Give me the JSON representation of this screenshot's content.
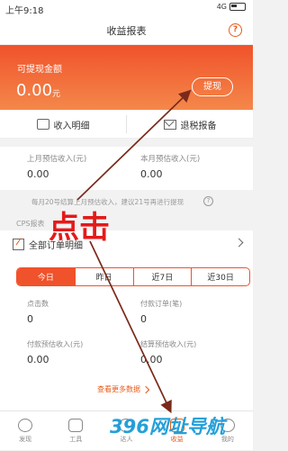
{
  "status_bar": {
    "time": "上午9:18",
    "signal": "4G",
    "battery": "battery-icon"
  },
  "header": {
    "title": "收益报表",
    "help_icon": "question-circle-icon"
  },
  "balance": {
    "label": "可提现金额",
    "amount": "0.00",
    "unit": "元",
    "withdraw_label": "提现",
    "gradient_start": "#f0522b",
    "gradient_end": "#f4884a"
  },
  "actions": {
    "income_detail": "收入明细",
    "refund_declare": "退税报备"
  },
  "estimates": {
    "last_month_label": "上月预估收入(元)",
    "last_month_value": "0.00",
    "this_month_label": "本月预估收入(元)",
    "this_month_value": "0.00"
  },
  "note": {
    "text": "每月20号结算上月预估收入，建议21号再进行提现"
  },
  "cps": {
    "label": "CPS报表"
  },
  "orders": {
    "title": "全部订单明细",
    "tabs": [
      "今日",
      "昨日",
      "近7日",
      "近30日"
    ],
    "active_tab": 0,
    "stats": [
      {
        "label": "点击数",
        "value": "0"
      },
      {
        "label": "付款订单(笔)",
        "value": "0"
      },
      {
        "label": "付款预估收入(元)",
        "value": "0.00"
      },
      {
        "label": "结算预估收入(元)",
        "value": "0.00"
      }
    ],
    "more_link": "查看更多数据"
  },
  "bottom_nav": [
    {
      "label": "发现",
      "icon": "compass-icon"
    },
    {
      "label": "工具",
      "icon": "toolbox-icon"
    },
    {
      "label": "达人",
      "icon": "person-icon"
    },
    {
      "label": "收益",
      "icon": "wallet-icon"
    },
    {
      "label": "我的",
      "icon": "user-icon"
    }
  ],
  "annotation": {
    "text": "点击"
  },
  "watermark": {
    "text": "396网址导航"
  },
  "colors": {
    "accent": "#f0522b",
    "annotation": "#e41a1a"
  }
}
